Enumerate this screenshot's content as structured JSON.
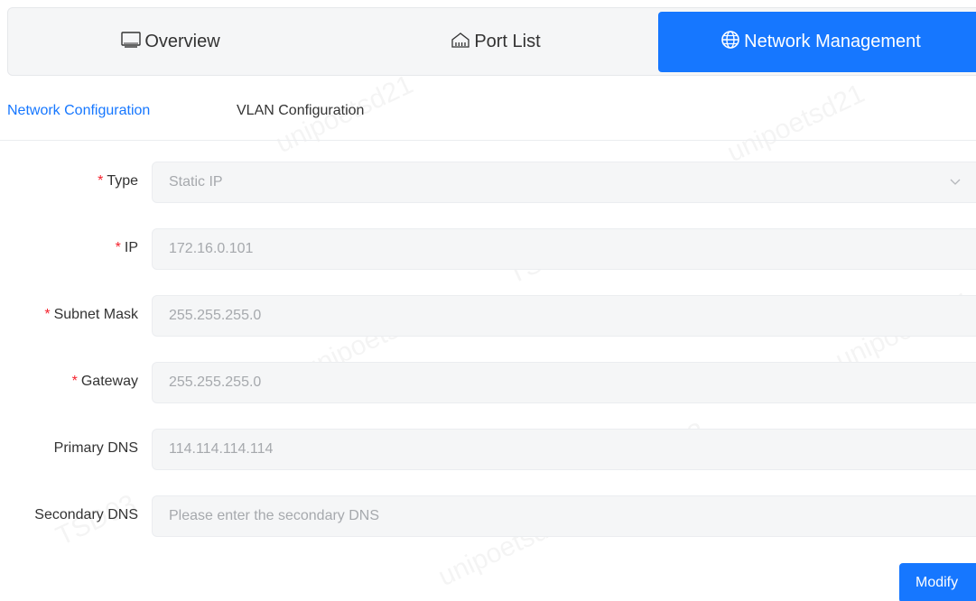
{
  "tabs": [
    {
      "label": "Overview",
      "icon": "monitor-icon",
      "active": false
    },
    {
      "label": "Port List",
      "icon": "switch-ports-icon",
      "active": false
    },
    {
      "label": "Network Management",
      "icon": "globe-icon",
      "active": true
    }
  ],
  "subtabs": [
    {
      "label": "Network Configuration",
      "active": true
    },
    {
      "label": "VLAN Configuration",
      "active": false
    }
  ],
  "form": {
    "type": {
      "label": "Type",
      "required": true,
      "value": "Static IP"
    },
    "ip": {
      "label": "IP",
      "required": true,
      "value": "172.16.0.101"
    },
    "subnet_mask": {
      "label": "Subnet Mask",
      "required": true,
      "value": "255.255.255.0"
    },
    "gateway": {
      "label": "Gateway",
      "required": true,
      "value": "255.255.255.0"
    },
    "primary_dns": {
      "label": "Primary DNS",
      "required": false,
      "value": "114.114.114.114"
    },
    "secondary_dns": {
      "label": "Secondary DNS",
      "required": false,
      "value": "",
      "placeholder": "Please enter the secondary DNS"
    }
  },
  "actions": {
    "modify_label": "Modify"
  },
  "watermark": {
    "text_a": "unipoetsd21",
    "text_b": "TSD03"
  },
  "colors": {
    "accent": "#1677ff",
    "required": "#f5222d"
  }
}
